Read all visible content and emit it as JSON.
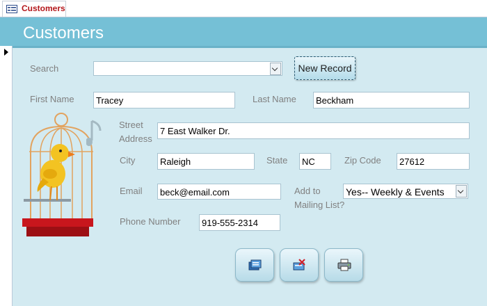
{
  "tab": {
    "label": "Customers",
    "icon": "form-icon"
  },
  "form": {
    "title": "Customers"
  },
  "search": {
    "label": "Search",
    "value": ""
  },
  "new_record_button": {
    "label": "New Record"
  },
  "fields": {
    "first_name": {
      "label": "First Name",
      "value": "Tracey"
    },
    "last_name": {
      "label": "Last Name",
      "value": "Beckham"
    },
    "street_address": {
      "label_line1": "Street",
      "label_line2": "Address",
      "value": "7 East Walker Dr."
    },
    "city": {
      "label": "City",
      "value": "Raleigh"
    },
    "state": {
      "label": "State",
      "value": "NC"
    },
    "zip": {
      "label": "Zip Code",
      "value": "27612"
    },
    "email": {
      "label": "Email",
      "value": "beck@email.com"
    },
    "mailing_list": {
      "label_line1": "Add to",
      "label_line2": "Mailing List?",
      "value": "Yes-- Weekly & Events"
    },
    "phone": {
      "label": "Phone Number",
      "value": "919-555-2314"
    }
  },
  "action_buttons": [
    {
      "icon": "save-record-icon"
    },
    {
      "icon": "delete-record-icon"
    },
    {
      "icon": "print-icon"
    }
  ],
  "colors": {
    "header": "#75c0d6",
    "background": "#d3eaf1",
    "tab_label": "#b3171b"
  }
}
